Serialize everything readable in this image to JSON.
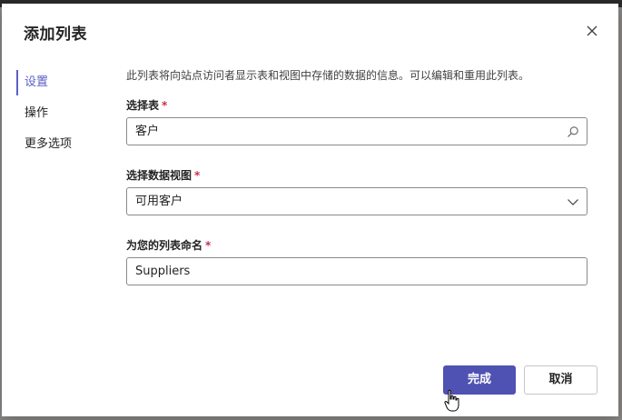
{
  "dialog": {
    "title": "添加列表"
  },
  "nav": {
    "items": [
      {
        "label": "设置",
        "selected": true
      },
      {
        "label": "操作",
        "selected": false
      },
      {
        "label": "更多选项",
        "selected": false
      }
    ]
  },
  "settings": {
    "description": "此列表将向站点访问者显示表和视图中存储的数据的信息。可以编辑和重用此列表。",
    "table_field": {
      "label": "选择表",
      "required_mark": "*",
      "value": "客户",
      "icon": "search-icon"
    },
    "view_field": {
      "label": "选择数据视图",
      "required_mark": "*",
      "value": "可用客户",
      "icon": "chevron-down-icon"
    },
    "name_field": {
      "label": "为您的列表命名",
      "required_mark": "*",
      "value": "Suppliers"
    }
  },
  "footer": {
    "done_label": "完成",
    "cancel_label": "取消"
  },
  "colors": {
    "accent": "#5b5fc7",
    "primary_button": "#4f52b2",
    "required": "#c4314b"
  }
}
